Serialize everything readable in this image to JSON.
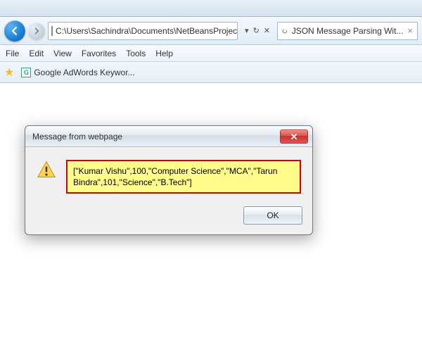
{
  "address_bar": {
    "url": "C:\\Users\\Sachindra\\Documents\\NetBeansProjects\\JSONP"
  },
  "nav_controls": {
    "dropdown": "▾",
    "refresh": "↻",
    "stop": "✕"
  },
  "tab": {
    "title": "JSON Message Parsing Wit..."
  },
  "menubar": {
    "file": "File",
    "edit": "Edit",
    "view": "View",
    "favorites": "Favorites",
    "tools": "Tools",
    "help": "Help"
  },
  "bookmarks": {
    "item1": {
      "favicon_letter": "G",
      "label": "Google AdWords Keywor..."
    }
  },
  "dialog": {
    "title": "Message from webpage",
    "message": "[\"Kumar Vishu\",100,\"Computer Science\",\"MCA\",\"Tarun Bindra\",101,\"Science\",\"B.Tech\"]",
    "ok_label": "OK"
  }
}
